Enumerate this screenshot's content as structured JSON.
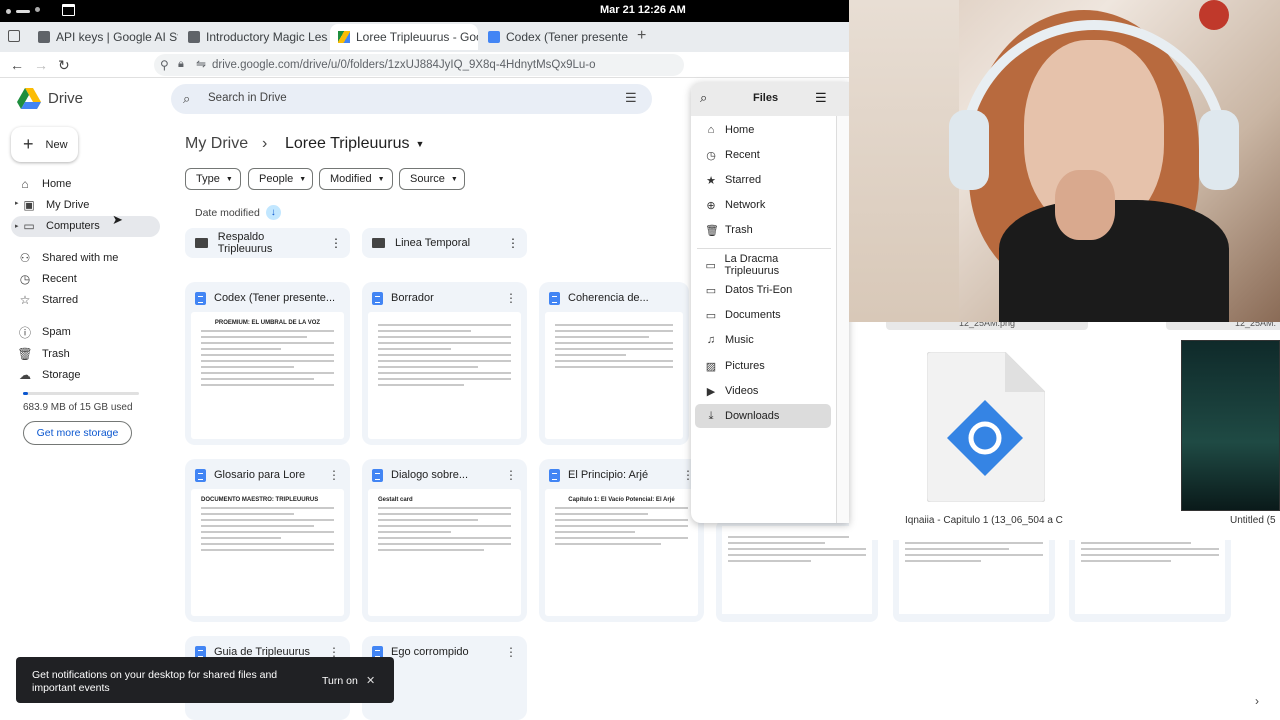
{
  "system": {
    "clock": "Mar 21  12:26 AM"
  },
  "tabs": [
    {
      "label": "API keys | Google AI Studi",
      "color": "#5f6368"
    },
    {
      "label": "Introductory Magic Lesso",
      "color": "#5f6368"
    },
    {
      "label": "Loree Tripleuurus - Goog",
      "color": "#1e8e3e"
    },
    {
      "label": "Codex (Tener presente us",
      "color": "#4285f4"
    }
  ],
  "address": {
    "url": "drive.google.com/drive/u/0/folders/1zxUJ884JyIQ_9X8q-4HdnytMsQx9Lu-o"
  },
  "drive": {
    "brand": "Drive",
    "search_placeholder": "Search in Drive",
    "new_label": "New",
    "nav": [
      "Home",
      "My Drive",
      "Computers",
      "Shared with me",
      "Recent",
      "Starred",
      "Spam",
      "Trash",
      "Storage"
    ],
    "storage_text": "683.9 MB of 15 GB used",
    "storage_fraction": 0.046,
    "storage_button": "Get more storage",
    "breadcrumb_root": "My Drive",
    "breadcrumb_current": "Loree Tripleuurus",
    "filters": [
      "Type",
      "People",
      "Modified",
      "Source"
    ],
    "sort_label": "Date modified",
    "folders": [
      "Respaldo Tripleuurus",
      "Linea Temporal"
    ],
    "docs": [
      {
        "name": "Codex (Tener presente...",
        "thumb_title": "PROEMIUM: EL UMBRAL DE LA VOZ"
      },
      {
        "name": "Borrador",
        "thumb_title": ""
      },
      {
        "name": "Coherencia de...",
        "thumb_title": ""
      },
      {
        "name": "Glosario para Lore",
        "thumb_title": "DOCUMENTO MAESTRO: TRIPLEUURUS"
      },
      {
        "name": "Dialogo sobre...",
        "thumb_title": "Gestalt card"
      },
      {
        "name": "El Principio: Arjé",
        "thumb_title": "Capítulo 1: El Vacío Potencial: El Arjé"
      },
      {
        "name": "Guia de Tripleuurus",
        "thumb_title": ""
      },
      {
        "name": "Ego corrompido",
        "thumb_title": ""
      }
    ]
  },
  "files_app": {
    "title": "Files",
    "places": [
      "Home",
      "Recent",
      "Starred",
      "Network",
      "Trash"
    ],
    "bookmarks": [
      "La Dracma Tripleuurus",
      "Datos Tri-Eon",
      "Documents",
      "Music",
      "Pictures",
      "Videos",
      "Downloads"
    ],
    "selected": "Downloads",
    "file_partial_1": "12_25AM.png",
    "file_partial_2": "12_25AM.",
    "file_name": "Iqnaiia - Capitulo 1 (13_06_504 a C",
    "file_name_2": "Untitled (5"
  },
  "toast": {
    "text": "Get notifications on your desktop for shared files and important events",
    "action": "Turn on"
  }
}
